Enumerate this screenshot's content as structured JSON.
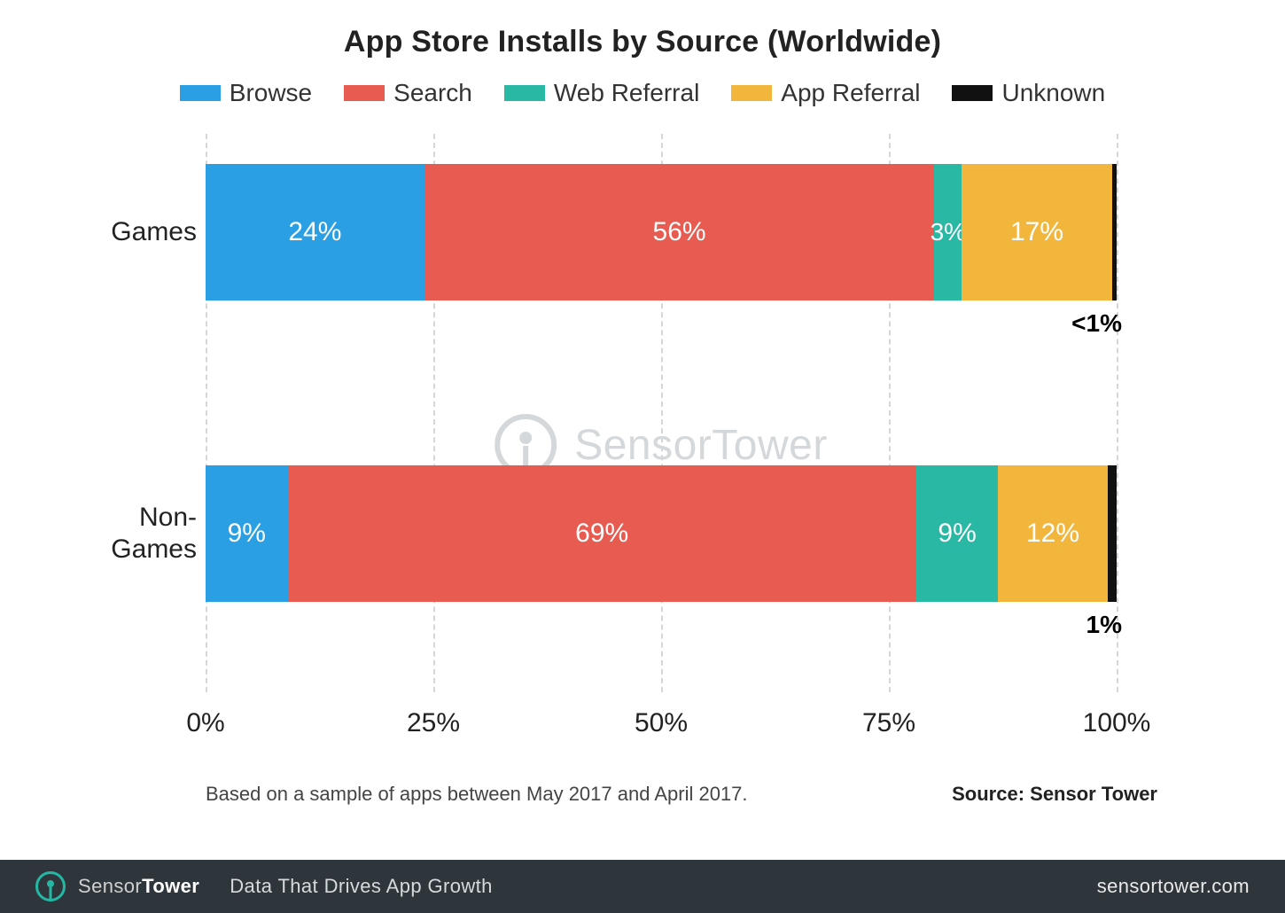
{
  "title": "App Store Installs by Source (Worldwide)",
  "legend": [
    {
      "label": "Browse",
      "color": "#2a9fe4"
    },
    {
      "label": "Search",
      "color": "#e75b50"
    },
    {
      "label": "Web Referral",
      "color": "#29b8a4"
    },
    {
      "label": "App Referral",
      "color": "#f2b63d"
    },
    {
      "label": "Unknown",
      "color": "#111111"
    }
  ],
  "x_ticks": [
    "0%",
    "25%",
    "50%",
    "75%",
    "100%"
  ],
  "footnote_left": "Based on a sample of apps between May 2017 and April 2017.",
  "footnote_right": "Source: Sensor Tower",
  "watermark": "SensorTower",
  "bottombar": {
    "brand_thin": "Sensor",
    "brand_bold": "Tower",
    "tagline": "Data That Drives App Growth",
    "site": "sensortower.com"
  },
  "chart_data": {
    "type": "bar",
    "stacked": true,
    "orientation": "horizontal",
    "xlabel": "",
    "ylabel": "",
    "xlim": [
      0,
      100
    ],
    "categories": [
      "Games",
      "Non-Games"
    ],
    "series": [
      {
        "name": "Browse",
        "values": [
          24,
          9
        ],
        "labels": [
          "24%",
          "9%"
        ],
        "color": "#2a9fe4"
      },
      {
        "name": "Search",
        "values": [
          56,
          69
        ],
        "labels": [
          "56%",
          "69%"
        ],
        "color": "#e75b50"
      },
      {
        "name": "Web Referral",
        "values": [
          3,
          9
        ],
        "labels": [
          "3%",
          "9%"
        ],
        "color": "#29b8a4"
      },
      {
        "name": "App Referral",
        "values": [
          17,
          12
        ],
        "labels": [
          "17%",
          "12%"
        ],
        "color": "#f2b63d"
      },
      {
        "name": "Unknown",
        "values": [
          0.5,
          1
        ],
        "labels": [
          "<1%",
          "1%"
        ],
        "color": "#111111",
        "label_outside": true
      }
    ]
  }
}
